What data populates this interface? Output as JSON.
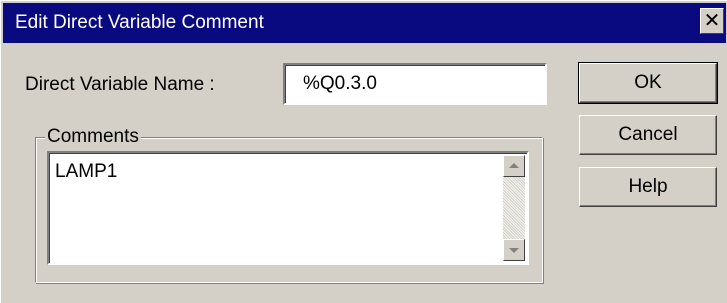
{
  "window": {
    "title": "Edit Direct Variable Comment",
    "close_symbol": "✕"
  },
  "form": {
    "name_label": "Direct Variable Name :",
    "name_value": "%Q0.3.0",
    "comments_label": "Comments",
    "comments_value": "LAMP1"
  },
  "buttons": {
    "ok": "OK",
    "cancel": "Cancel",
    "help": "Help"
  },
  "icons": {
    "close": "close-icon",
    "scroll_up": "scroll-up-arrow-icon",
    "scroll_down": "scroll-down-arrow-icon"
  }
}
